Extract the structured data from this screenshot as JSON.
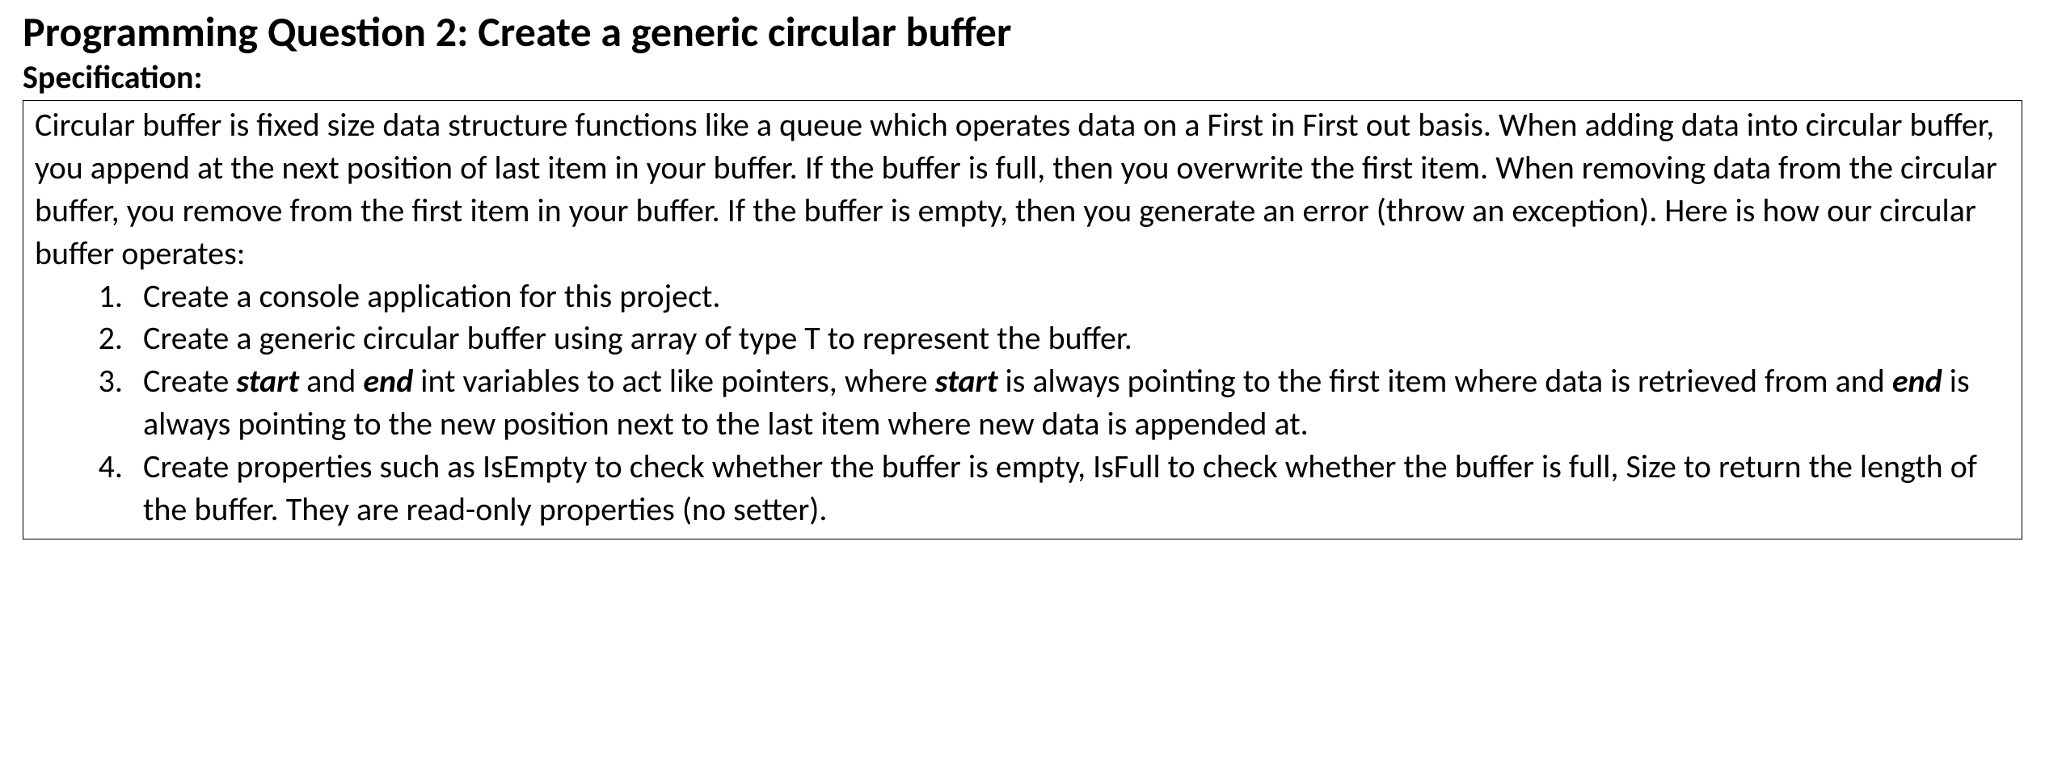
{
  "title": "Programming Question 2: Create a generic circular buffer",
  "subheading": "Specification:",
  "intro": {
    "t1": "Circular buffer is fixed size data structure functions like a queue which operates data on a First in First out basis. When adding data into circular buffer, you append at the next position of last item in your buffer. If the buffer is full, then you overwrite the first item. When removing data from the circular buffer, you remove from the first item in your buffer.  If the buffer is empty, then you generate an error (throw an exception).  Here is how our circular buffer operates:"
  },
  "steps": {
    "s1": "Create a console application for this project.",
    "s2": "Create a generic circular buffer using array of type T to represent the buffer.",
    "s3": {
      "a": "Create ",
      "b": "start",
      "c": " and ",
      "d": "end",
      "e": " int variables to act like pointers, where ",
      "f": "start",
      "g": " is always pointing to the first item where data is retrieved from and ",
      "h": "end",
      "i": " is always pointing to the new position next to the last item where new data is appended at."
    },
    "s4": "Create properties such as IsEmpty to check whether the buffer is empty, IsFull to check whether the buffer is full, Size to return the length of the buffer. They are read-only properties (no setter)."
  }
}
